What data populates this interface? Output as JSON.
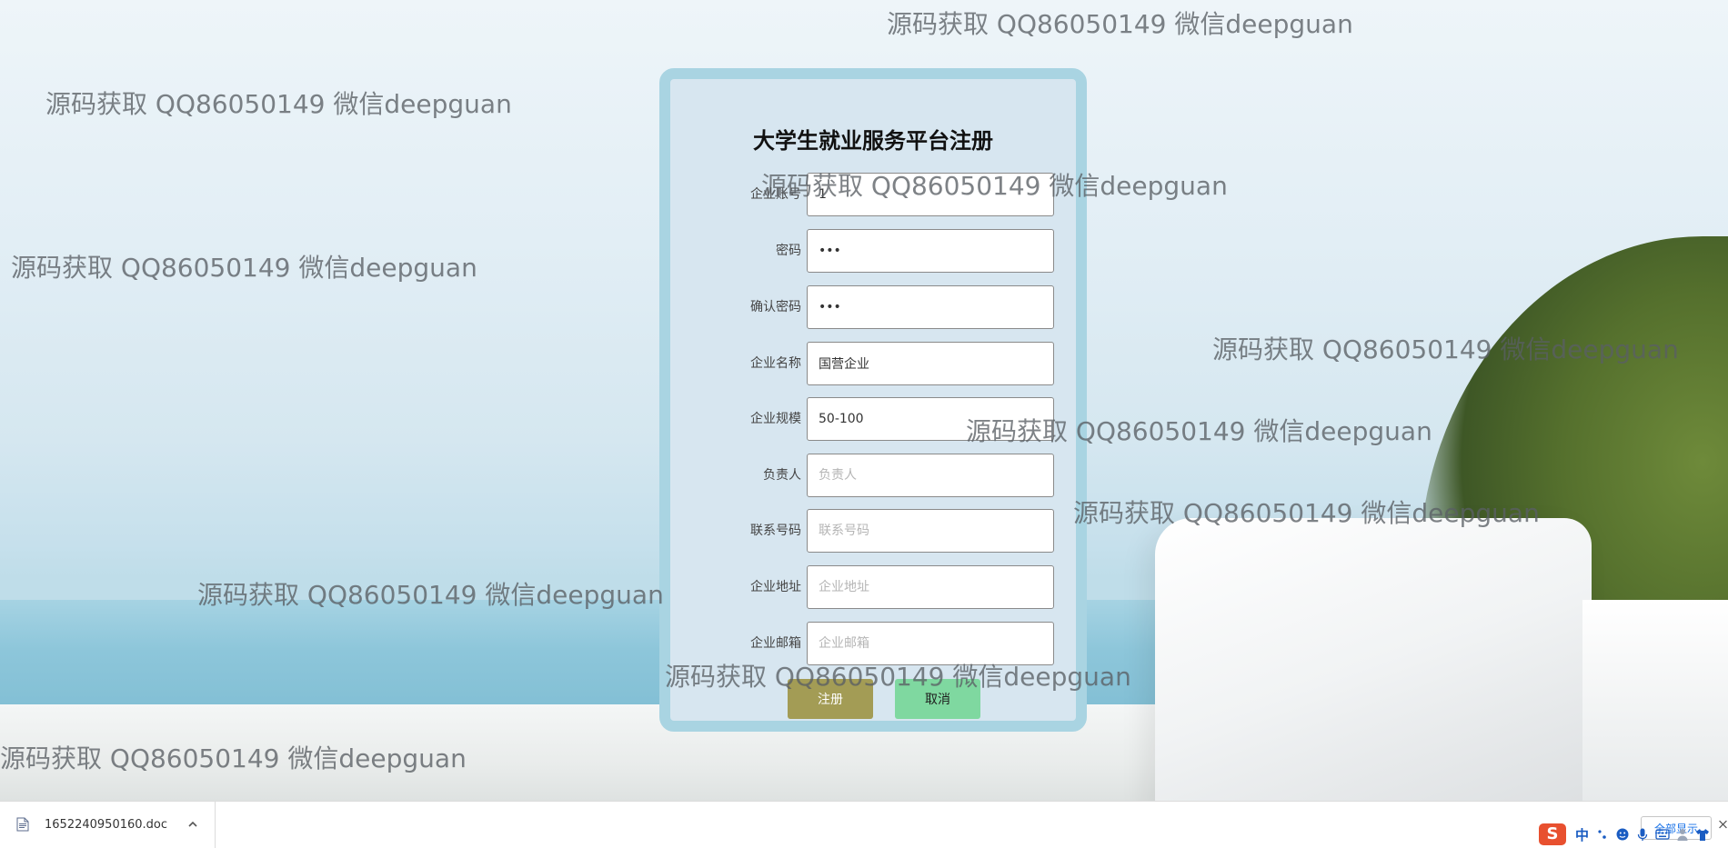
{
  "form": {
    "title": "大学生就业服务平台注册",
    "fields": [
      {
        "label": "企业账号",
        "value": "1",
        "placeholder": "企业账号",
        "type": "text"
      },
      {
        "label": "密码",
        "value": "123",
        "placeholder": "密码",
        "type": "password"
      },
      {
        "label": "确认密码",
        "value": "123",
        "placeholder": "确认密码",
        "type": "password"
      },
      {
        "label": "企业名称",
        "value": "国营企业",
        "placeholder": "企业名称",
        "type": "text"
      },
      {
        "label": "企业规模",
        "value": "50-100",
        "placeholder": "企业规模",
        "type": "text"
      },
      {
        "label": "负责人",
        "value": "",
        "placeholder": "负责人",
        "type": "text"
      },
      {
        "label": "联系号码",
        "value": "",
        "placeholder": "联系号码",
        "type": "text"
      },
      {
        "label": "企业地址",
        "value": "",
        "placeholder": "企业地址",
        "type": "text"
      },
      {
        "label": "企业邮箱",
        "value": "",
        "placeholder": "企业邮箱",
        "type": "text"
      }
    ],
    "register_label": "注册",
    "cancel_label": "取消"
  },
  "watermark_text": "源码获取 QQ86050149 微信deepguan",
  "download_bar": {
    "file_name": "1652240950160.doc",
    "show_all_label": "全部显示"
  },
  "ime": {
    "logo": "S",
    "mode": "中"
  }
}
